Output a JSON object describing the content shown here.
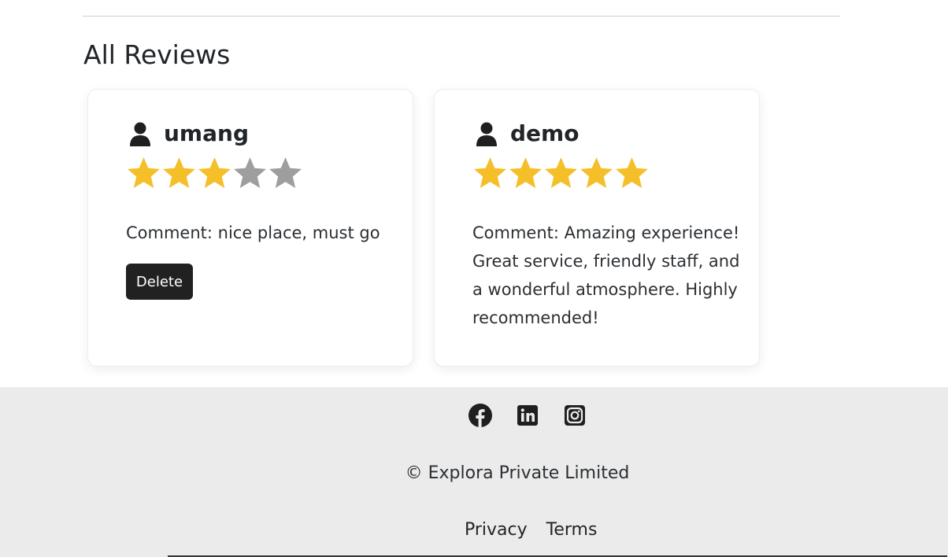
{
  "section": {
    "title": "All Reviews"
  },
  "reviews": [
    {
      "author": "umang",
      "rating": 3,
      "max_rating": 5,
      "comment": "Comment: nice place, must go",
      "delete_label": "Delete"
    },
    {
      "author": "demo",
      "rating": 5,
      "max_rating": 5,
      "comment": "Comment: Amazing experience! Great service, friendly staff, and a wonderful atmosphere. Highly recommended!"
    }
  ],
  "footer": {
    "social": [
      "facebook-icon",
      "linkedin-icon",
      "instagram-icon"
    ],
    "copyright": "© Explora Private Limited",
    "links": [
      "Privacy",
      "Terms"
    ]
  },
  "colors": {
    "star_filled": "#f5bf2a",
    "star_empty": "#9e9e9e",
    "footer_bg": "#ebebeb",
    "button_bg": "#212121"
  }
}
